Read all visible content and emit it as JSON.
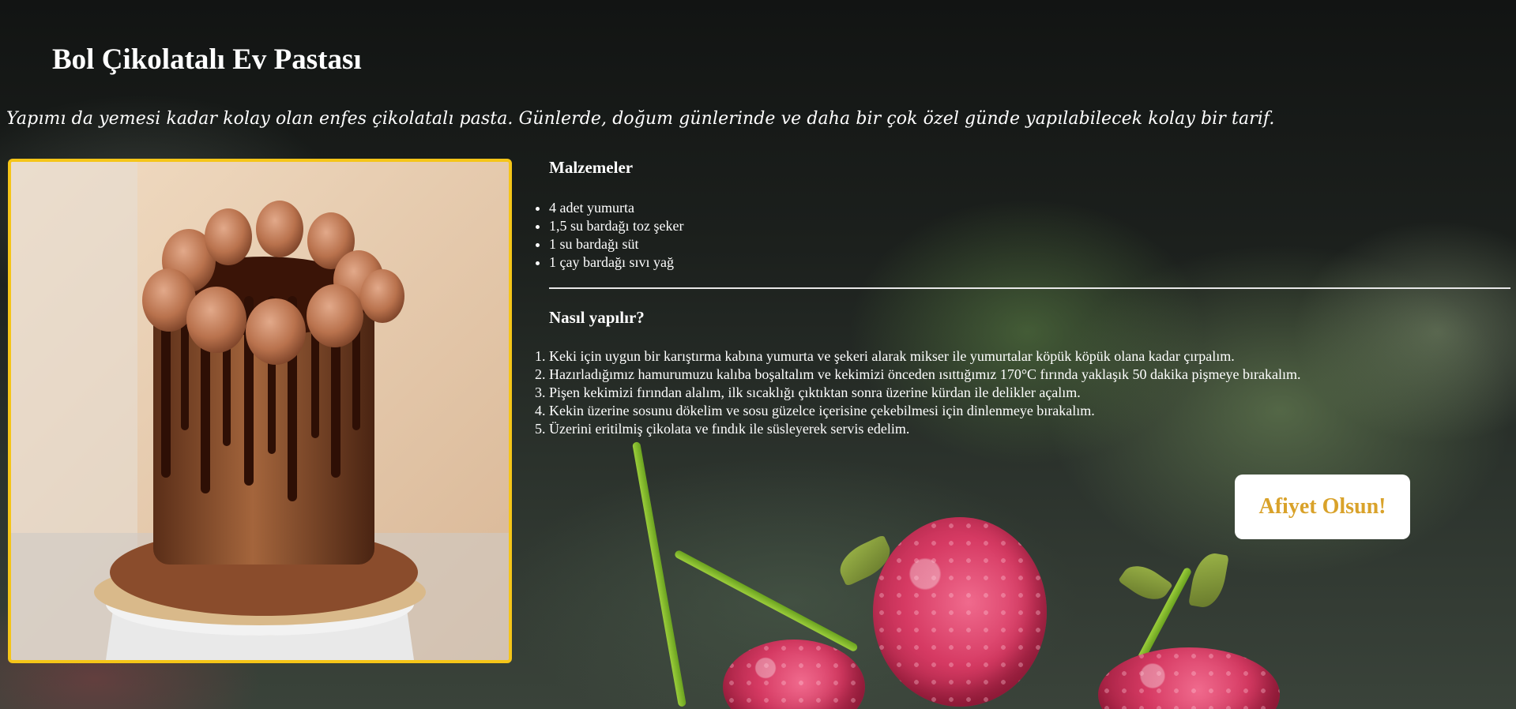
{
  "page": {
    "title": "Bol Çikolatalı Ev Pastası",
    "subtitle": "Yapımı da yemesi kadar kolay olan enfes çikolatalı pasta. Günlerde, doğum günlerinde ve daha bir çok özel günde yapılabilecek kolay bir tarif."
  },
  "ingredients": {
    "heading": "Malzemeler",
    "items": [
      "4 adet yumurta",
      "1,5 su bardağı toz şeker",
      "1 su bardağı süt",
      "1 çay bardağı sıvı yağ"
    ]
  },
  "steps": {
    "heading": "Nasıl yapılır?",
    "items": [
      "Keki için uygun bir karıştırma kabına yumurta ve şekeri alarak mikser ile yumurtalar köpük köpük olana kadar çırpalım.",
      "Hazırladığımız hamurumuzu kalıba boşaltalım ve kekimizi önceden ısıttığımız 170°C fırında yaklaşık 50 dakika pişmeye bırakalım.",
      "Pişen kekimizi fırından alalım, ilk sıcaklığı çıktıktan sonra üzerine kürdan ile delikler açalım.",
      "Kekin üzerine sosunu dökelim ve sosu güzelce içerisine çekebilmesi için dinlenmeye bırakalım.",
      "Üzerini eritilmiş çikolata ve fındık ile süsleyerek servis edelim."
    ]
  },
  "button": {
    "label": "Afiyet Olsun!"
  },
  "colors": {
    "frame_border": "#f5c518",
    "button_text": "#d9a22a",
    "button_bg": "#ffffff",
    "text": "#ffffff"
  }
}
